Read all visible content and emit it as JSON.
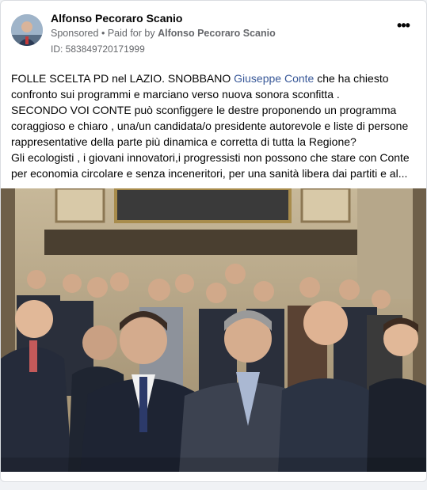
{
  "post": {
    "author": "Alfonso Pecoraro Scanio",
    "sponsored_label": "Sponsored",
    "separator": "•",
    "paid_for_prefix": "Paid for by",
    "paid_for_name": "Alfonso Pecoraro Scanio",
    "ad_id": "ID: 583849720171999",
    "more_icon": "more-options-icon",
    "text": {
      "line1_part1": "FOLLE SCELTA PD nel LAZIO. SNOBBANO ",
      "line1_link": "Giuseppe Conte",
      "line1_part2": " che ha chiesto confronto sui programmi e marciano verso nuova sonora sconfitta .",
      "para2": "SECONDO VOI CONTE può sconfiggere le destre proponendo un programma coraggioso e chiaro , una/un candidata/o presidente autorevole e liste di persone rappresentative della parte più dinamica e corretta di tutta la Regione?",
      "para3_line1": "Gli ecologisti , i giovani innovatori,i progressisti non possono che stare con Conte",
      "para3_line2": "per economia circolare e senza inceneritori, per una sanità libera dai partiti e al..."
    }
  },
  "colors": {
    "link": "#385898",
    "meta": "#65676b",
    "text": "#050505"
  }
}
